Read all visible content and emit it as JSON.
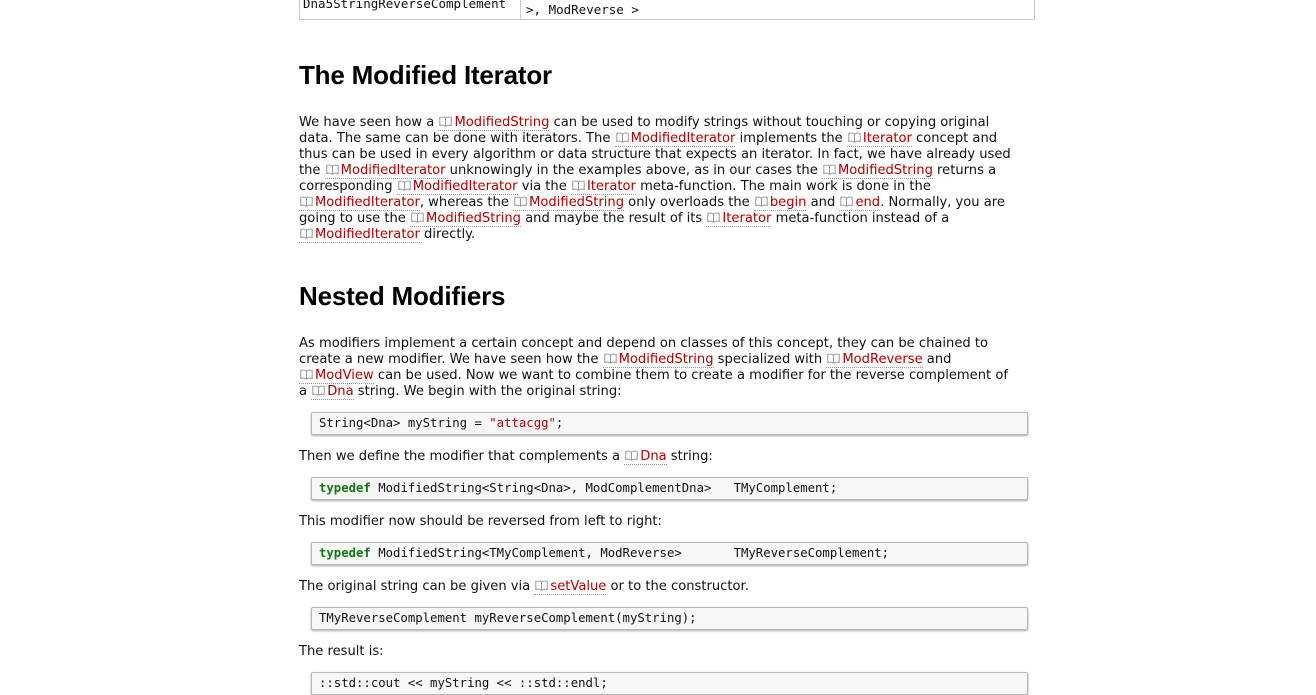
{
  "top_table": {
    "cell_name": "Dna5StringReverseComplement",
    "cell_code_tail": ">, ModReverse >"
  },
  "section_modified_iterator": {
    "heading": "The Modified Iterator",
    "paragraph_lines": [
      [
        {
          "t": "We have seen how a "
        },
        {
          "r": "ModifiedString"
        },
        {
          "t": " can be used to modify strings without touching or copying original"
        }
      ],
      [
        {
          "t": "data. The same can be done with iterators. The "
        },
        {
          "r": "ModifiedIterator"
        },
        {
          "t": " implements the "
        },
        {
          "r": "Iterator"
        },
        {
          "t": " concept and"
        }
      ],
      [
        {
          "t": "thus can be used in every algorithm or data structure that expects an iterator. In fact, we have already used"
        }
      ],
      [
        {
          "t": "the "
        },
        {
          "r": "ModifiedIterator"
        },
        {
          "t": " unknowingly in the examples above, as in our cases the "
        },
        {
          "r": "ModifiedString"
        },
        {
          "t": " returns a"
        }
      ],
      [
        {
          "t": "corresponding "
        },
        {
          "r": "ModifiedIterator"
        },
        {
          "t": " via the "
        },
        {
          "r": "Iterator"
        },
        {
          "t": " meta-function. The main work is done in the"
        }
      ],
      [
        {
          "r": "ModifiedIterator"
        },
        {
          "t": ", whereas the "
        },
        {
          "r": "ModifiedString"
        },
        {
          "t": " only overloads the "
        },
        {
          "r": "begin"
        },
        {
          "t": " and "
        },
        {
          "r": "end"
        },
        {
          "t": ". Normally, you are"
        }
      ],
      [
        {
          "t": "going to use the "
        },
        {
          "r": "ModifiedString"
        },
        {
          "t": " and maybe the result of its "
        },
        {
          "r": "Iterator"
        },
        {
          "t": " meta-function instead of a"
        }
      ],
      [
        {
          "r": "ModifiedIterator"
        },
        {
          "t": " directly."
        }
      ]
    ]
  },
  "section_nested_modifiers": {
    "heading": "Nested Modifiers",
    "intro_lines": [
      [
        {
          "t": "As modifiers implement a certain concept and depend on classes of this concept, they can be chained to"
        }
      ],
      [
        {
          "t": "create a new modifier. We have seen how the "
        },
        {
          "r": "ModifiedString"
        },
        {
          "t": " specialized with "
        },
        {
          "r": "ModReverse"
        },
        {
          "t": " and"
        }
      ],
      [
        {
          "r": "ModView"
        },
        {
          "t": " can be used. Now we want to combine them to create a modifier for the reverse complement of"
        }
      ],
      [
        {
          "t": "a "
        },
        {
          "r": "Dna"
        },
        {
          "t": " string. We begin with the original string:"
        }
      ]
    ],
    "code1": {
      "plain_a": "String<Dna> myString = ",
      "string_literal": "\"attacgg\"",
      "plain_b": ";"
    },
    "text2": [
      {
        "t": "Then we define the modifier that complements a "
      },
      {
        "r": "Dna"
      },
      {
        "t": " string:"
      }
    ],
    "code2": {
      "keyword": "typedef",
      "rest": " ModifiedString<String<Dna>, ModComplementDna>   TMyComplement;"
    },
    "text3": [
      {
        "t": "This modifier now should be reversed from left to right:"
      }
    ],
    "code3": {
      "keyword": "typedef",
      "rest": " ModifiedString<TMyComplement, ModReverse>       TMyReverseComplement;"
    },
    "text4": [
      {
        "t": "The original string can be given via "
      },
      {
        "r": "setValue"
      },
      {
        "t": " or to the constructor."
      }
    ],
    "code4": {
      "text": "TMyReverseComplement myReverseComplement(myString);"
    },
    "text5": [
      {
        "t": "The result is:"
      }
    ],
    "code5": {
      "text": "::std::cout << myString << ::std::endl;"
    }
  },
  "icons": {
    "reference_link": "book-icon"
  },
  "colors": {
    "link": "#b00000",
    "keyword": "#117711",
    "code_bg": "#f7f7f7"
  }
}
